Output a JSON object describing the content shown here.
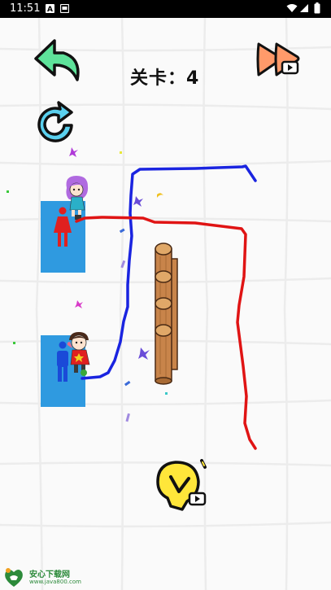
{
  "status_bar": {
    "time": "11:51",
    "left_icons": [
      "notification-a-icon",
      "notification-card-icon"
    ],
    "right_icons": [
      "wifi-icon",
      "signal-icon",
      "battery-icon"
    ]
  },
  "hud": {
    "level_text": "关卡：4",
    "back_icon": "back-arrow-icon",
    "skip_icon": "fast-forward-video-icon",
    "restart_icon": "restart-icon",
    "hint_icon": "lightbulb-video-icon"
  },
  "scene": {
    "girl_icon": "female-restroom-icon",
    "boy_icon": "male-restroom-icon",
    "obstacle": "wooden-log-fence",
    "line_colors": {
      "blue": "#1a24e0",
      "red": "#e01414"
    },
    "door_color": "#2f9ae0"
  },
  "watermark": {
    "brand": "安心下载网",
    "url": "www.java800.com"
  },
  "colors": {
    "back_arrow": "#5ee29a",
    "restart_arrow": "#5ad0ee",
    "skip_arrow": "#ff9a6a",
    "hint_bulb": "#ffe63a"
  }
}
